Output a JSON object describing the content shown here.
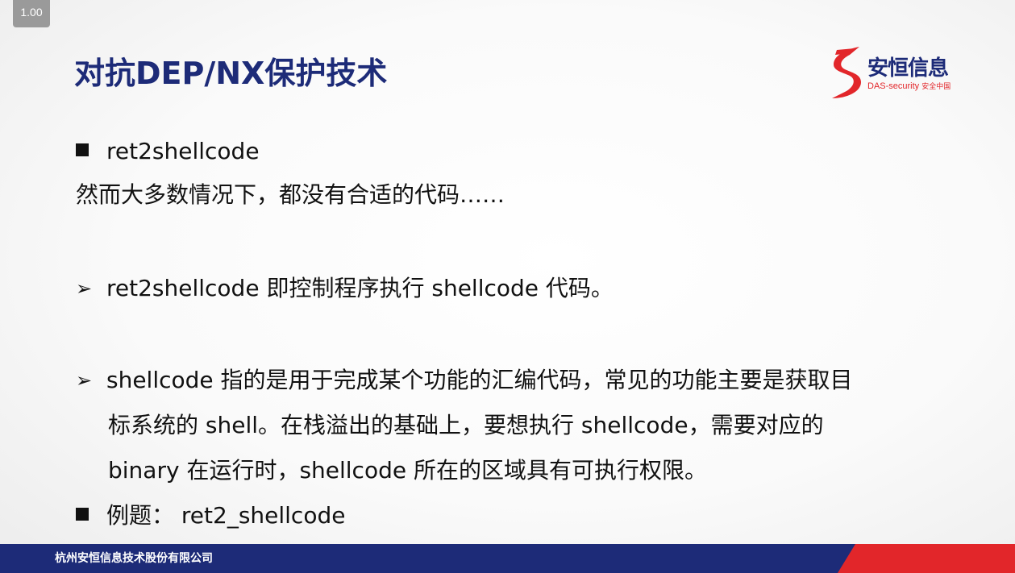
{
  "player": {
    "zoom_label": "1.00"
  },
  "slide": {
    "title": "对抗DEP/NX保护技术",
    "logo": {
      "name": "安恒信息",
      "subtitle": "DAS-security",
      "subtitle_cn": "安全中国"
    },
    "lines": [
      {
        "bullet": "square",
        "text": "ret2shellcode"
      },
      {
        "bullet": "none",
        "text": "然而大多数情况下，都没有合适的代码……"
      },
      {
        "bullet": "arrow",
        "text": "ret2shellcode 即控制程序执行 shellcode 代码。"
      },
      {
        "bullet": "arrow",
        "text": "shellcode 指的是用于完成某个功能的汇编代码，常见的功能主要是获取目"
      },
      {
        "bullet": "none",
        "text": "标系统的 shell。在栈溢出的基础上，要想执行 shellcode，需要对应的"
      },
      {
        "bullet": "none",
        "text": "binary 在运行时，shellcode 所在的区域具有可执行权限。"
      },
      {
        "bullet": "square",
        "text": "例题：  ret2_shellcode"
      }
    ],
    "footer_text": "杭州安恒信息技术股份有限公司"
  },
  "colors": {
    "title": "#1d2b78",
    "brand_red": "#e2262a",
    "footer_blue": "#1d2b78"
  }
}
